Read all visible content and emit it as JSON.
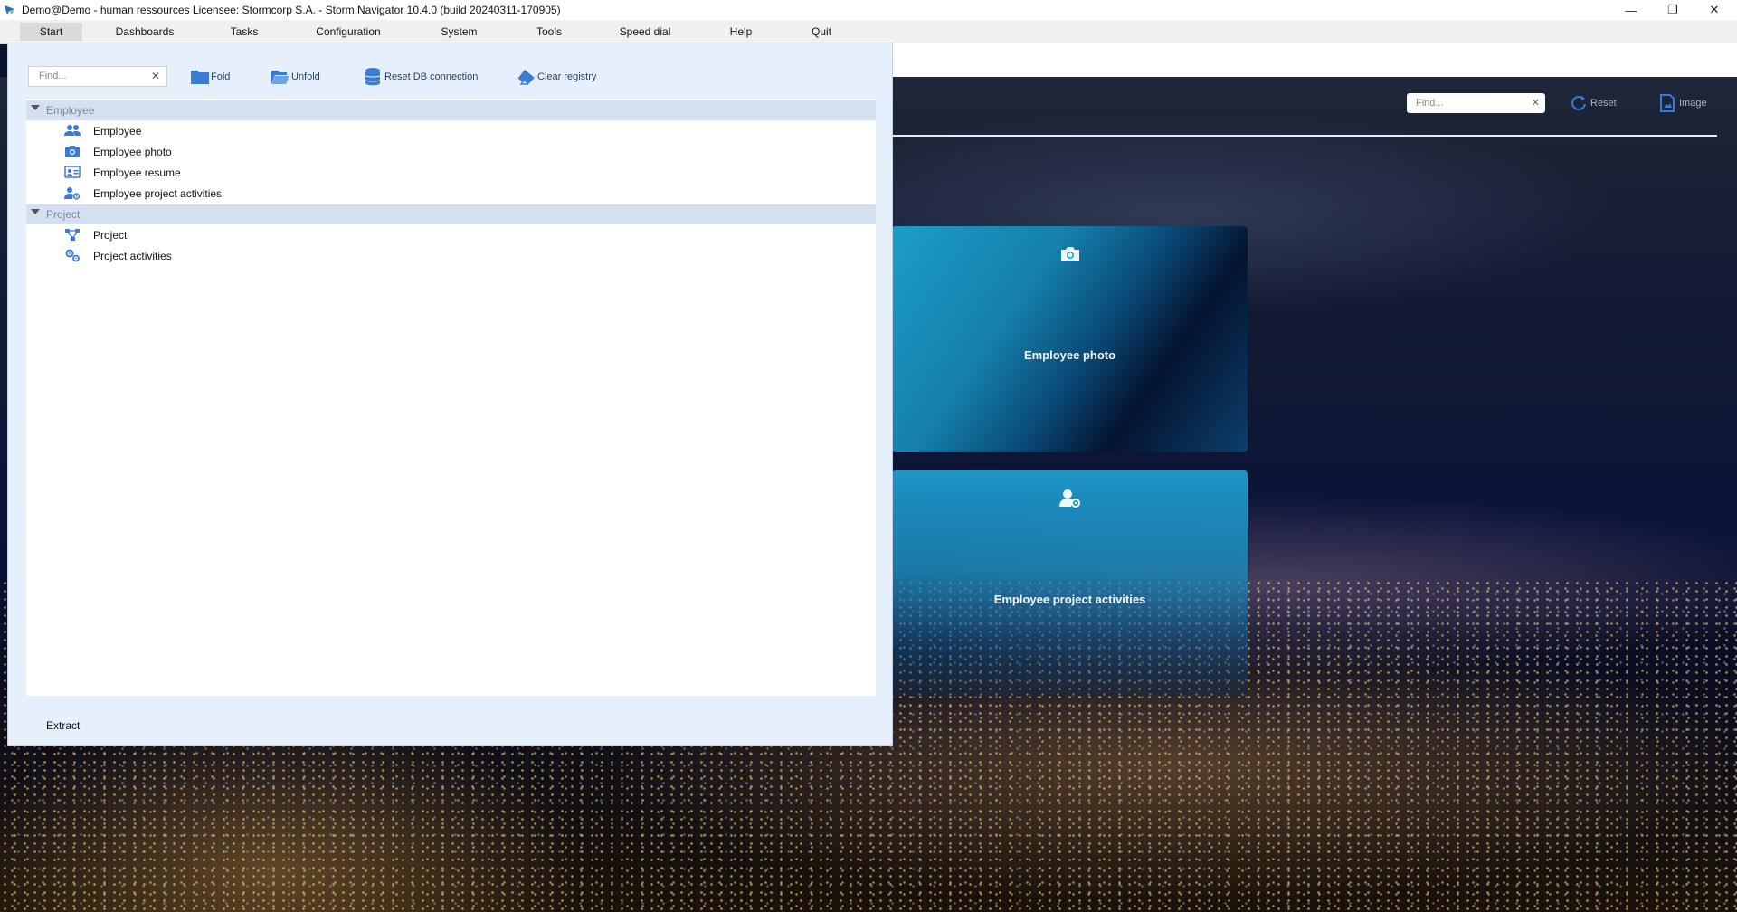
{
  "window": {
    "title": "Demo@Demo - human ressources    Licensee: Stormcorp S.A. -  Storm Navigator 10.4.0 (build 20240311-170905)",
    "controls": {
      "minimize": "—",
      "maximize": "❐",
      "close": "✕"
    }
  },
  "menu": {
    "items": [
      "Start",
      "Dashboards",
      "Tasks",
      "Configuration",
      "System",
      "Tools",
      "Speed dial",
      "Help",
      "Quit"
    ],
    "active": "Start"
  },
  "panel": {
    "find_placeholder": "Find...",
    "toolbar": {
      "fold": "Fold",
      "unfold": "Unfold",
      "reset_db": "Reset DB connection",
      "clear_registry": "Clear registry"
    },
    "tree": [
      {
        "group": "Employee",
        "expanded": true,
        "items": [
          {
            "label": "Employee",
            "icon": "users-icon"
          },
          {
            "label": "Employee photo",
            "icon": "camera-icon"
          },
          {
            "label": "Employee resume",
            "icon": "id-card-icon"
          },
          {
            "label": "Employee project activities",
            "icon": "user-gear-icon"
          }
        ]
      },
      {
        "group": "Project",
        "expanded": true,
        "items": [
          {
            "label": "Project",
            "icon": "diagram-icon"
          },
          {
            "label": "Project activities",
            "icon": "gears-icon"
          }
        ]
      }
    ],
    "footer": "Extract"
  },
  "dashboard": {
    "find_placeholder": "Find...",
    "reset": "Reset",
    "image": "Image",
    "tiles": [
      {
        "label": "Employee photo",
        "icon": "camera-icon"
      },
      {
        "label": "Employee project activities",
        "icon": "user-gear-icon"
      }
    ]
  },
  "colors": {
    "accent": "#3a7bd5",
    "group_bg": "#d3e0f0",
    "panel_bg": "#e6f0fd",
    "tile_blue": "#1a9ec8"
  }
}
